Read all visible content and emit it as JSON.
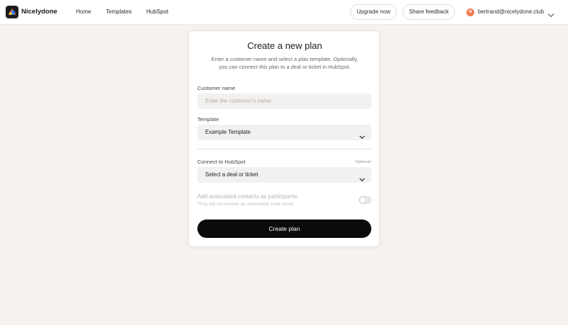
{
  "app": {
    "name": "Nicelydone"
  },
  "nav": {
    "items": [
      "Home",
      "Templates",
      "HubSpot"
    ]
  },
  "header": {
    "upgrade_label": "Upgrade now",
    "feedback_label": "Share feedback",
    "user_initials": "M",
    "user_email": "bertrand@nicelydone.club"
  },
  "form": {
    "title": "Create a new plan",
    "description_line1": "Enter a customer name and select a plan template. Optionally,",
    "description_line2": "you can connect this plan to a deal or ticket in HubSpot.",
    "customer_label": "Customer name",
    "customer_placeholder": "Enter the customer's name",
    "customer_value": "",
    "template_label": "Template",
    "template_value": "Example Template",
    "hubspot_label": "Connect to HubSpot",
    "hubspot_optional": "Optional",
    "hubspot_value": "Select a deal or ticket",
    "participants_title": "Add associated contacts as participants",
    "participants_subtitle": "They will not receive an automated invite email.",
    "participants_enabled": false,
    "submit_label": "Create plan"
  },
  "colors": {
    "background": "#f6f2ef",
    "primary": "#0b0b0b",
    "avatar": "#f07a4f",
    "field_bg": "#f3f1ef"
  },
  "icons": [
    "app-logo-icon",
    "chevron-down-icon"
  ]
}
